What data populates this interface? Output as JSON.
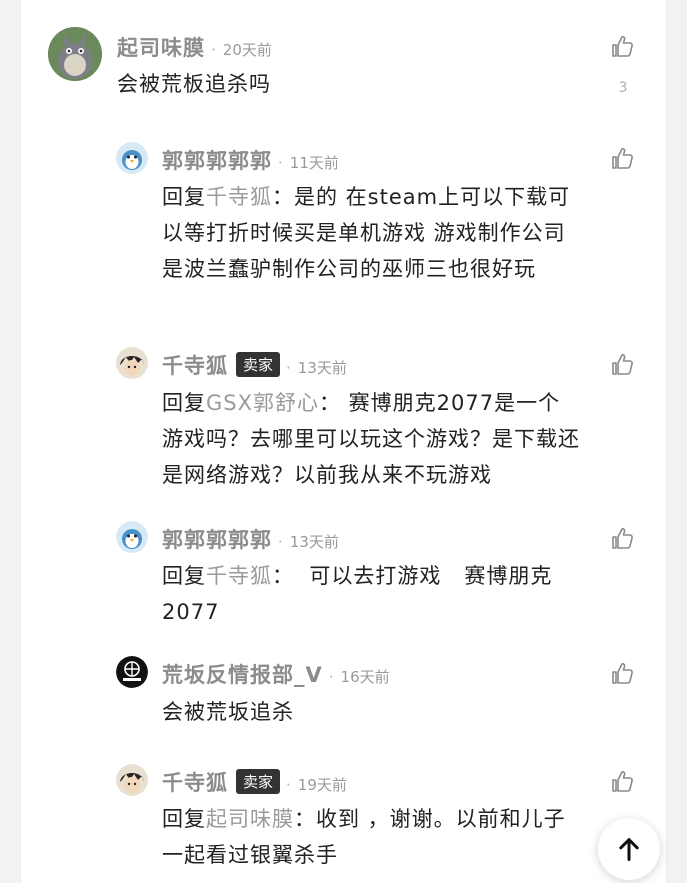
{
  "comments": [
    {
      "name": "起司味膜",
      "time": "20天前",
      "text": "会被荒板追杀吗",
      "likes": "3",
      "avatar": "totoro-avatar"
    },
    {
      "name": "郭郭郭郭郭",
      "time": "11天前",
      "reply_prefix": "回复",
      "reply_to": "千寺狐",
      "reply_sep": "：",
      "text": "是的  在steam上可以下载可以等打折时候买是单机游戏  游戏制作公司是波兰蠢驴制作公司的巫师三也很好玩",
      "avatar": "penguin-avatar"
    },
    {
      "name": "千寺狐",
      "badge": "卖家",
      "time": "13天前",
      "reply_prefix": "回复",
      "reply_to": "GSX郭舒心",
      "reply_sep": "：",
      "text": " 赛博朋克2077是一个游戏吗？去哪里可以玩这个游戏？是下载还是网络游戏？以前我从来不玩游戏",
      "avatar": "anime-avatar"
    },
    {
      "name": "郭郭郭郭郭",
      "time": "13天前",
      "reply_prefix": "回复",
      "reply_to": "千寺狐",
      "reply_sep": "：",
      "text": "  可以去打游戏   赛博朋克2077",
      "avatar": "penguin-avatar"
    },
    {
      "name": "荒坂反情报部_V",
      "time": "16天前",
      "text": "会被荒坂追杀",
      "avatar": "arasaka-logo-avatar"
    },
    {
      "name": "千寺狐",
      "badge": "卖家",
      "time": "19天前",
      "reply_prefix": "回复",
      "reply_to": "起司味膜",
      "reply_sep": "：",
      "text": "收到 ，谢谢。以前和儿子一起看过银翼杀手",
      "avatar": "anime-avatar"
    }
  ],
  "separator": "·",
  "colors": {
    "badge_bg": "#333333",
    "meta": "#9a9a9a",
    "text": "#222222"
  },
  "icons": {
    "like": "thumbs-up-icon",
    "scroll_top": "arrow-up-icon"
  }
}
